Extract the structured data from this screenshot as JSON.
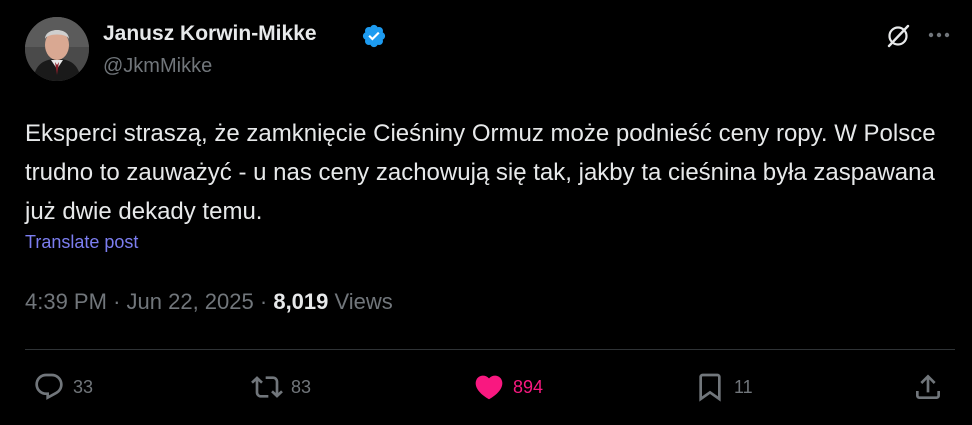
{
  "author": {
    "display_name": "Janusz Korwin-Mikke",
    "handle": "@JkmMikke",
    "verified": true
  },
  "post": {
    "text": "Eksperci straszą, że zamknięcie Cieśniny Ormuz może podnieść ceny ropy. W Polsce trudno to zauważyć - u nas ceny zachowują się tak, jakby ta cieśnina była zaspawana już dwie dekady temu.",
    "translate_label": "Translate post",
    "time": "4:39 PM",
    "date": "Jun 22, 2025",
    "separator": "·",
    "views_count": "8,019",
    "views_label": "Views"
  },
  "actions": {
    "replies": "33",
    "reposts": "83",
    "likes": "894",
    "bookmarks": "11"
  },
  "icons": {
    "header": [
      "grok-icon",
      "more-icon"
    ],
    "actions": [
      "reply-icon",
      "repost-icon",
      "like-icon",
      "bookmark-icon",
      "share-icon"
    ]
  },
  "colors": {
    "background": "#000000",
    "text": "#e7e9ea",
    "secondary": "#71767b",
    "link": "#7c7ef0",
    "verified": "#1d9bf0",
    "like": "#f91880"
  }
}
